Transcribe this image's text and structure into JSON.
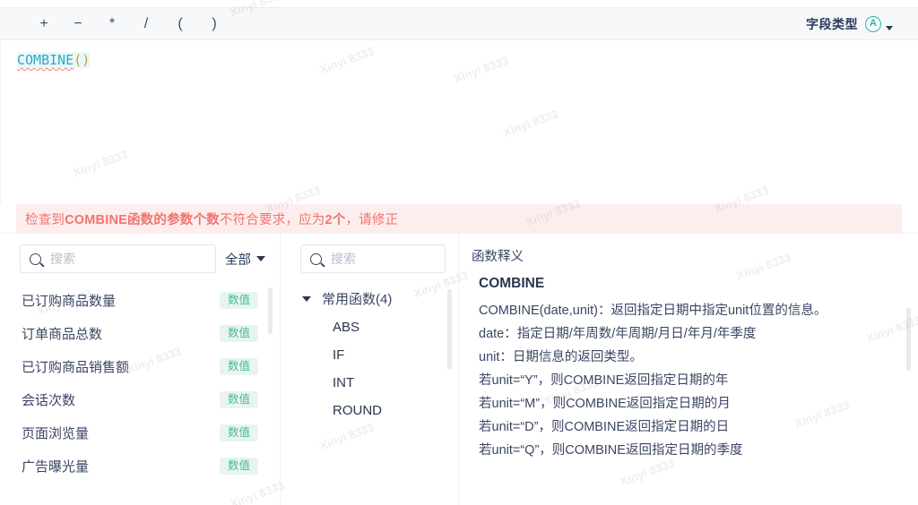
{
  "toolbar": {
    "operators": [
      "+",
      "−",
      "*",
      "/",
      "(",
      ")"
    ],
    "field_type_label": "字段类型",
    "field_type_icon": "circled-a-icon",
    "field_type_icon_glyph": "A",
    "dropdown_icon": "chevron-down-icon",
    "accent_color": "#2ab6ae",
    "background": "#f7f8fa"
  },
  "editor": {
    "formula_function": "COMBINE",
    "formula_parens": "()",
    "function_color": "#2fa8c4",
    "paren_color": "#c9a227",
    "error_underline_color": "#f2807c"
  },
  "error": {
    "part1": "检查到 ",
    "bold1": "COMBINE函数的参数个数",
    "part2": " 不符合要求，应为 ",
    "bold2": "2个",
    "part3": "，请修正",
    "text_color": "#f2736e",
    "background": "#fdeeee"
  },
  "fields_panel": {
    "search_placeholder": "搜索",
    "search_value": "",
    "search_icon": "search-icon",
    "filter_label": "全部",
    "filter_icon": "caret-down-icon",
    "items": [
      {
        "name": "已订购商品数量",
        "type": "数值"
      },
      {
        "name": "订单商品总数",
        "type": "数值"
      },
      {
        "name": "已订购商品销售额",
        "type": "数值"
      },
      {
        "name": "会话次数",
        "type": "数值"
      },
      {
        "name": "页面浏览量",
        "type": "数值"
      },
      {
        "name": "广告曝光量",
        "type": "数值"
      }
    ],
    "badge_bg": "#e7f5f0",
    "badge_color": "#4bb79f"
  },
  "functions_panel": {
    "search_placeholder": "搜索",
    "search_value": "",
    "search_icon": "search-icon",
    "group_label": "常用函数(4)",
    "group_icon": "triangle-down-icon",
    "group_expanded": true,
    "items": [
      "ABS",
      "IF",
      "INT",
      "ROUND"
    ]
  },
  "description_panel": {
    "title": "函数释义",
    "function_name": "COMBINE",
    "lines": [
      "COMBINE(date,unit)：返回指定日期中指定unit位置的信息。",
      "date：指定日期/年周数/年周期/月日/年月/年季度",
      "unit：日期信息的返回类型。",
      "若unit=“Y”，则COMBINE返回指定日期的年",
      "若unit=“M”，则COMBINE返回指定日期的月",
      "若unit=“D”，则COMBINE返回指定日期的日",
      "若unit=“Q”，则COMBINE返回指定日期的季度"
    ]
  },
  "watermark": {
    "text": "Xinyi 8333"
  }
}
